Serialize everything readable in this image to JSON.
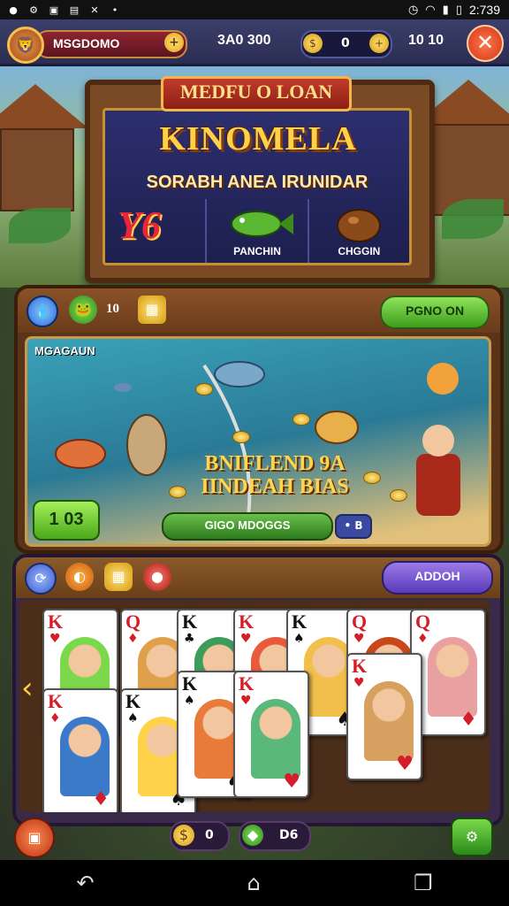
{
  "status_bar": {
    "time": "2:739",
    "icons": [
      "notification-icon",
      "settings-icon",
      "image-icon",
      "chart-icon",
      "mute-icon",
      "wifi-icon",
      "signal-icon",
      "battery-icon"
    ]
  },
  "hud": {
    "player_name": "MSGDOMO",
    "score": "3A0 300",
    "coin_value": "0",
    "right_value": "10 10",
    "plus_glyph": "+",
    "close_glyph": "✕"
  },
  "title_board": {
    "banner": "MEDFU O LOAN",
    "title": "KINOMELA",
    "subtitle": "SORABH ANEA IRUNIDAR",
    "slot_number": "Y6",
    "slot_fish_label": "PANCHIN",
    "slot_coin_label": "CHGGIN"
  },
  "mid_panel": {
    "count_value": "10",
    "action_button": "PGNO ON",
    "scene_label": "MGAGAUN",
    "scene_headline_line1": "BNIFLEND 9A",
    "scene_headline_line2": "IINDEAH BIAS",
    "badge_value": "1 03",
    "capsule_label": "GIGO MDOGGS",
    "mini_label": "• B"
  },
  "card_panel": {
    "add_button": "ADDOH",
    "cards": [
      {
        "rank": "K",
        "suit": "♥",
        "color": "red"
      },
      {
        "rank": "Q",
        "suit": "♦",
        "color": "red"
      },
      {
        "rank": "K",
        "suit": "♣",
        "color": "black"
      },
      {
        "rank": "K",
        "suit": "♥",
        "color": "red"
      },
      {
        "rank": "K",
        "suit": "♠",
        "color": "black"
      },
      {
        "rank": "Q",
        "suit": "♥",
        "color": "red"
      },
      {
        "rank": "Q",
        "suit": "♦",
        "color": "red"
      },
      {
        "rank": "K",
        "suit": "♦",
        "color": "red"
      },
      {
        "rank": "K",
        "suit": "♠",
        "color": "black"
      },
      {
        "rank": "K",
        "suit": "♠",
        "color": "black"
      },
      {
        "rank": "K",
        "suit": "♥",
        "color": "red"
      },
      {
        "rank": "K",
        "suit": "♥",
        "color": "red"
      }
    ]
  },
  "bottom": {
    "coin_value": "0",
    "gem_value": "D6"
  },
  "colors": {
    "accent_gold": "#ffd24a",
    "panel_brown": "#5a3418",
    "button_green": "#3e9c1c",
    "button_purple": "#5a3ab8",
    "close_red": "#d2331a"
  }
}
